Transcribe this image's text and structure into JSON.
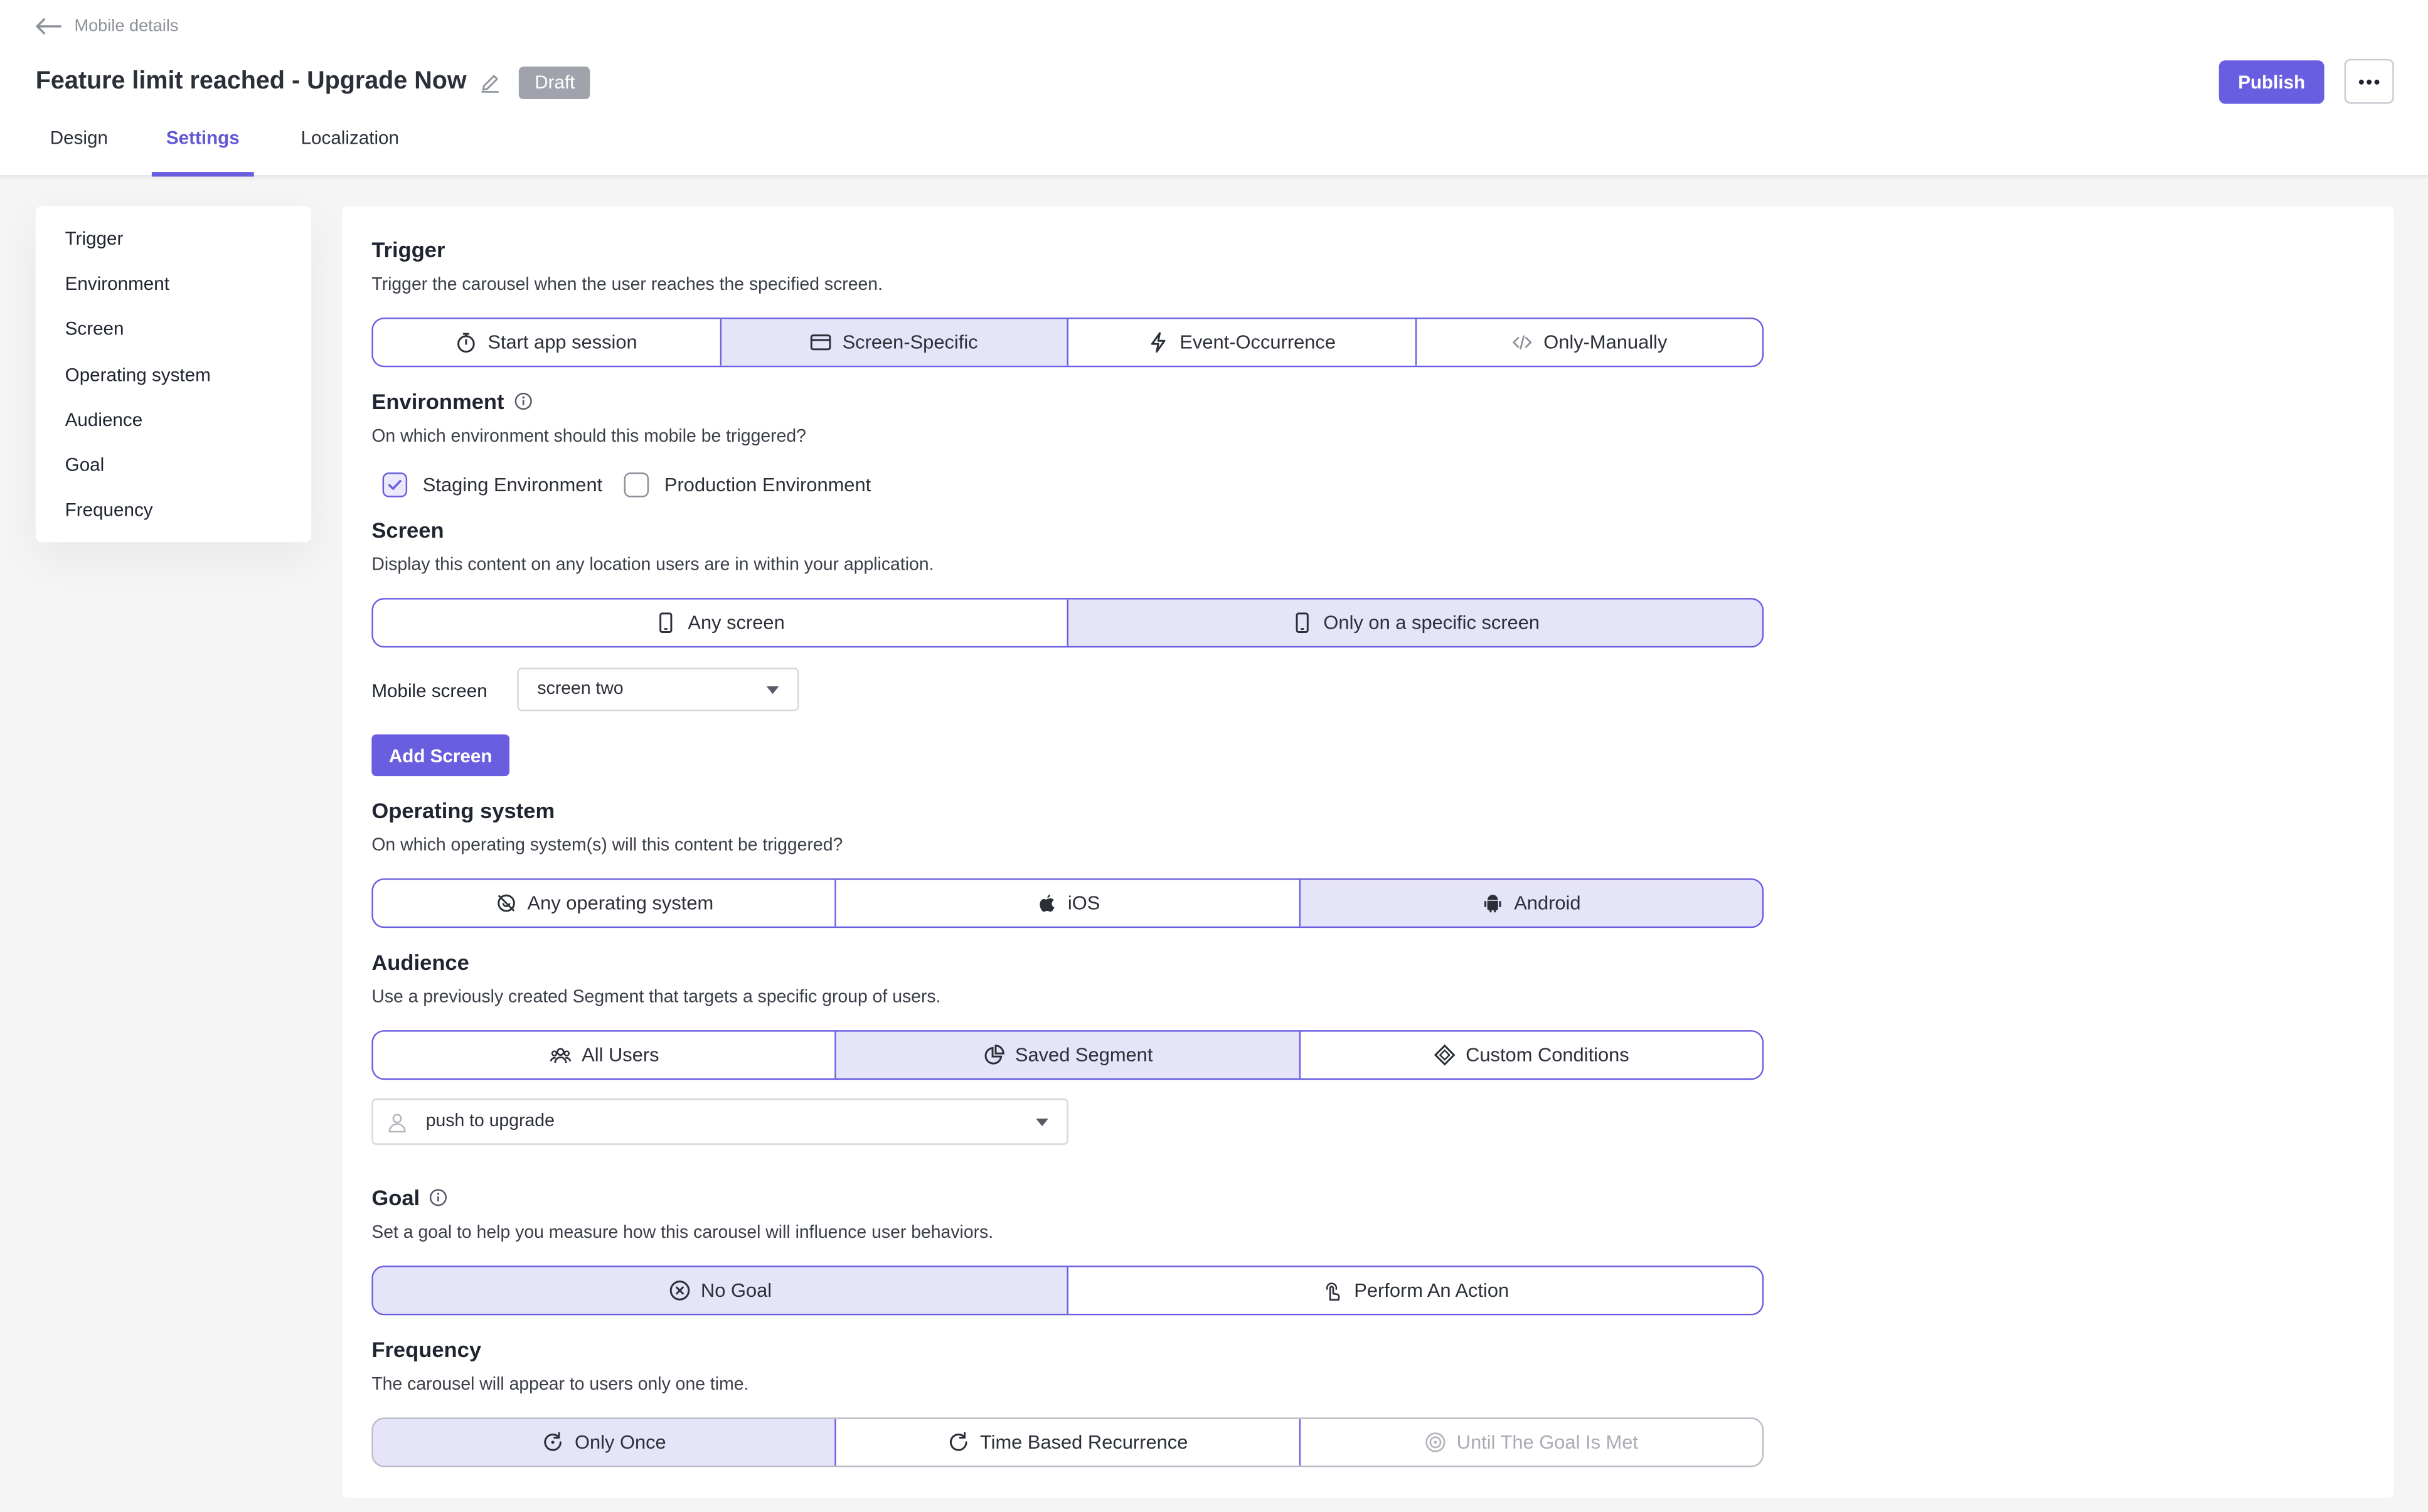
{
  "header": {
    "back_label": "Mobile details",
    "title": "Feature limit reached - Upgrade Now",
    "status_badge": "Draft",
    "publish_label": "Publish",
    "tabs": [
      {
        "label": "Design",
        "active": false
      },
      {
        "label": "Settings",
        "active": true
      },
      {
        "label": "Localization",
        "active": false
      }
    ]
  },
  "sidebar": {
    "items": [
      {
        "label": "Trigger"
      },
      {
        "label": "Environment"
      },
      {
        "label": "Screen"
      },
      {
        "label": "Operating system"
      },
      {
        "label": "Audience"
      },
      {
        "label": "Goal"
      },
      {
        "label": "Frequency"
      }
    ]
  },
  "trigger": {
    "title": "Trigger",
    "description": "Trigger the carousel when the user reaches the specified screen.",
    "options": [
      {
        "label": "Start app session",
        "icon": "timer-icon",
        "selected": false
      },
      {
        "label": "Screen-Specific",
        "icon": "window-icon",
        "selected": true
      },
      {
        "label": "Event-Occurrence",
        "icon": "lightning-icon",
        "selected": false
      },
      {
        "label": "Only-Manually",
        "icon": "code-icon",
        "selected": false
      }
    ]
  },
  "environment": {
    "title": "Environment",
    "description": "On which environment should this mobile be triggered?",
    "options": [
      {
        "label": "Staging Environment",
        "checked": true
      },
      {
        "label": "Production Environment",
        "checked": false
      }
    ]
  },
  "screen": {
    "title": "Screen",
    "description": "Display this content on any location users are in within your application.",
    "options": [
      {
        "label": "Any screen",
        "icon": "mobile-icon",
        "selected": false
      },
      {
        "label": "Only on a specific screen",
        "icon": "mobile-icon",
        "selected": true
      }
    ],
    "mobile_screen_label": "Mobile screen",
    "mobile_screen_value": "screen two",
    "add_screen_label": "Add Screen"
  },
  "os": {
    "title": "Operating system",
    "description": "On which operating system(s) will this content be triggered?",
    "options": [
      {
        "label": "Any operating system",
        "icon": "os-icon",
        "selected": false
      },
      {
        "label": "iOS",
        "icon": "apple-icon",
        "selected": false
      },
      {
        "label": "Android",
        "icon": "android-icon",
        "selected": true
      }
    ]
  },
  "audience": {
    "title": "Audience",
    "description": "Use a previously created Segment that targets a specific group of users.",
    "options": [
      {
        "label": "All Users",
        "icon": "users-icon",
        "selected": false
      },
      {
        "label": "Saved Segment",
        "icon": "pie-chart-icon",
        "selected": true
      },
      {
        "label": "Custom Conditions",
        "icon": "diamond-icon",
        "selected": false
      }
    ],
    "segment_value": "push to upgrade"
  },
  "goal": {
    "title": "Goal",
    "description": "Set a goal to help you measure how this carousel will influence user behaviors.",
    "options": [
      {
        "label": "No Goal",
        "icon": "x-circle-icon",
        "selected": true
      },
      {
        "label": "Perform An Action",
        "icon": "tap-icon",
        "selected": false
      }
    ]
  },
  "frequency": {
    "title": "Frequency",
    "description": "The carousel will appear to users only one time.",
    "options": [
      {
        "label": "Only Once",
        "icon": "refresh-icon",
        "selected": true
      },
      {
        "label": "Time Based Recurrence",
        "icon": "refresh-icon",
        "selected": false
      },
      {
        "label": "Until The Goal Is Met",
        "icon": "target-icon",
        "selected": false,
        "disabled": true
      }
    ]
  },
  "colors": {
    "accent": "#6a5ee0",
    "selected_bg": "#e6e4f9",
    "badge_gray": "#a0a3ab"
  }
}
